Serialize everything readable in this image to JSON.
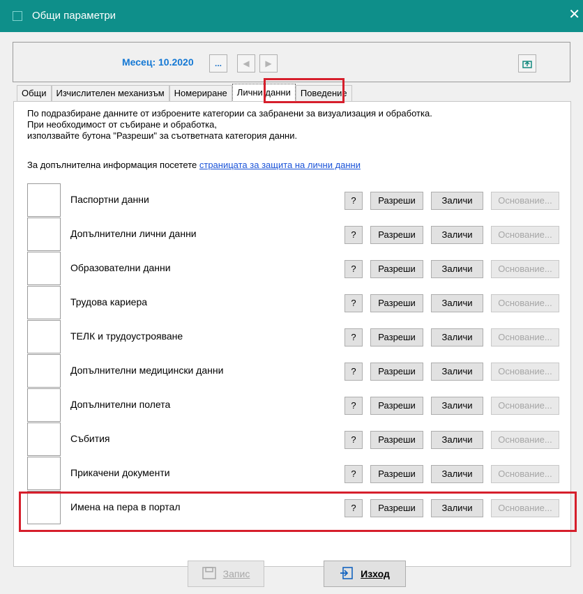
{
  "window": {
    "title": "Общи параметри",
    "close_glyph": "✕"
  },
  "toolbar": {
    "month_label": "Месец: 10.2020",
    "dots_label": "...",
    "prev_glyph": "◀",
    "next_glyph": "▶",
    "refresh_glyph": "⇅"
  },
  "tabs": [
    {
      "label": "Общи"
    },
    {
      "label": "Изчислителен механизъм"
    },
    {
      "label": "Номериране"
    },
    {
      "label": "Лични данни"
    },
    {
      "label": "Поведение"
    }
  ],
  "intro": {
    "line1": "По подразбиране данните от изброените категории са забранени за визуализация и обработка.",
    "line2": "При необходимост от събиране и обработка,",
    "line3": "използвайте бутона \"Разреши\" за съответната категория данни.",
    "more_prefix": "За допълнителна информация посетете ",
    "more_link": "страницата за защита на лични данни"
  },
  "buttons": {
    "help": "?",
    "allow": "Разреши",
    "erase": "Заличи",
    "basis": "Основание..."
  },
  "categories": [
    {
      "label": "Паспортни данни"
    },
    {
      "label": "Допълнителни лични данни"
    },
    {
      "label": "Образователни данни"
    },
    {
      "label": "Трудова кариера"
    },
    {
      "label": "ТЕЛК и трудоустрояване"
    },
    {
      "label": "Допълнителни медицински данни"
    },
    {
      "label": "Допълнителни полета"
    },
    {
      "label": "Събития"
    },
    {
      "label": "Прикачени документи"
    },
    {
      "label": "Имена на пера в портал"
    }
  ],
  "footer": {
    "save_label": "Запис",
    "exit_label": "Изход"
  },
  "colors": {
    "titlebar": "#0e8f8a",
    "accent": "#1478d4",
    "highlight": "#d61f2c",
    "link": "#1a53d8"
  }
}
